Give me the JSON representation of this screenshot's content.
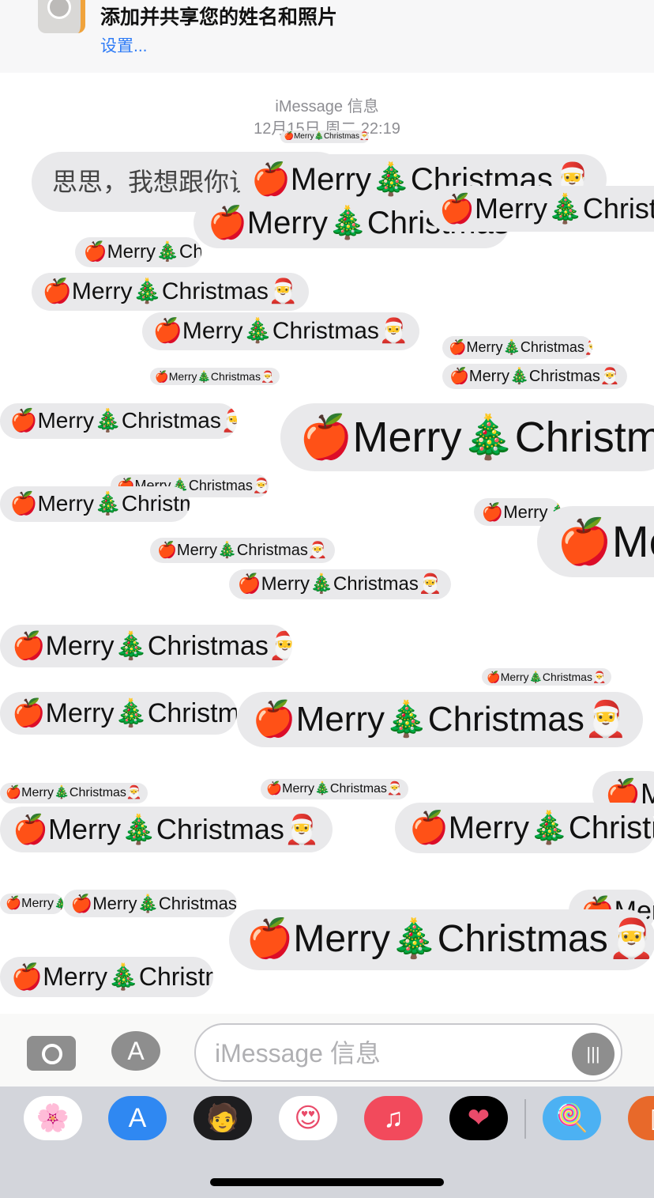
{
  "banner": {
    "title": "添加并共享您的姓名和照片",
    "link": "设置..."
  },
  "chat": {
    "service": "iMessage 信息",
    "timestamp": "12月15日 周二 22:19",
    "first_message": "思思，我想跟你谈恋爱",
    "repeated_message": "🍎Merry🎄Christmas🎅",
    "bubble_color": "#e9e9eb"
  },
  "input": {
    "placeholder": "iMessage 信息",
    "camera_icon": "camera-icon",
    "apps_icon": "app-store-icon",
    "audio_icon": "waveform-icon"
  },
  "dock": {
    "apps": [
      {
        "name": "photos",
        "glyph": "🌸",
        "bg": "#ffffff"
      },
      {
        "name": "app-store",
        "glyph": "A",
        "bg": "#2f88f2"
      },
      {
        "name": "memoji-camera",
        "glyph": "🧑",
        "bg": "#1d1d1f"
      },
      {
        "name": "memoji-stickers",
        "glyph": "😍",
        "bg": "#ffffff"
      },
      {
        "name": "music",
        "glyph": "♫",
        "bg": "#f24a5c"
      },
      {
        "name": "fitness-heart",
        "glyph": "❤",
        "bg": "#000000"
      },
      {
        "name": "popsicle-stickers",
        "glyph": "🍭",
        "bg": "#4cb1f3"
      },
      {
        "name": "orange-app",
        "glyph": "▯",
        "bg": "#e8692a"
      }
    ]
  }
}
